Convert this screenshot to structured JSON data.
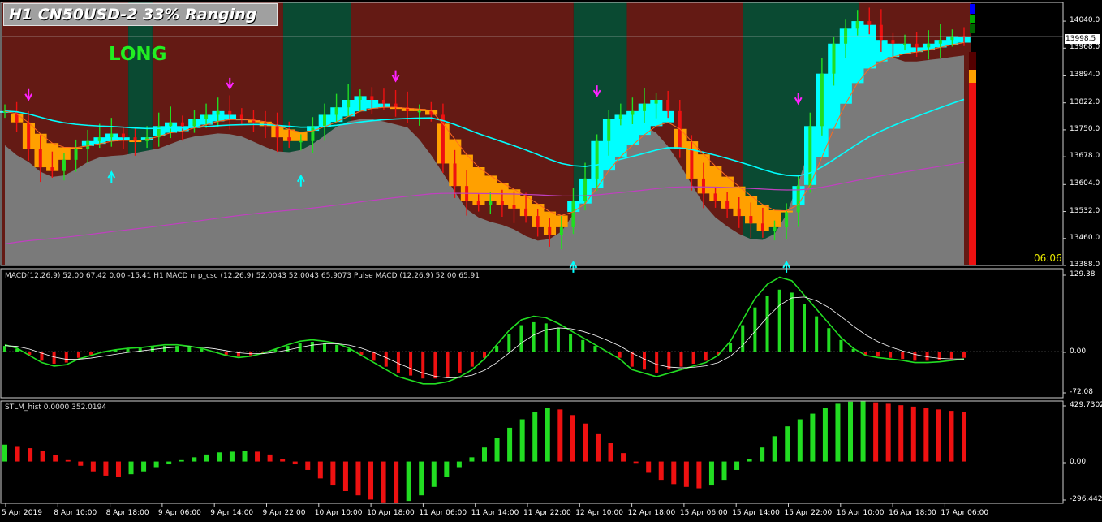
{
  "header": {
    "title": "H1 CN50USD-2  33% Ranging",
    "signal_label": "LONG",
    "countdown": "06:06"
  },
  "colors": {
    "background": "#000000",
    "bull_zone": "#0a4a32",
    "bear_zone": "#641a14",
    "cloud_fill": "#7a7a7a",
    "cyan_band": "#00ffff",
    "orange_band": "#ffa000",
    "green_bar": "#22dd22",
    "red_bar": "#ee1111",
    "magenta_line": "#c040c0",
    "signal_text": "#22ee22"
  },
  "price_axis": {
    "current_price": "13998.5",
    "ticks": [
      "14040.0",
      "13968.0",
      "13894.0",
      "13822.0",
      "13750.0",
      "13678.0",
      "13604.0",
      "13532.0",
      "13460.0",
      "13388.0"
    ]
  },
  "macd_panel": {
    "label": "MACD(12,26,9) 52.00 67.42 0.00 -15.41  H1 MACD nrp_csc (12,26,9) 52.0043 52.0043 65.9073  Pulse MACD (12,26,9) 52.00 65.91",
    "ticks": [
      "129.38",
      "0.00",
      "-72.08"
    ]
  },
  "stlm_panel": {
    "label": "STLM_hist 0.0000 352.0194",
    "ticks": [
      "429.7302",
      "0.00",
      "-296.4421"
    ]
  },
  "time_axis": {
    "labels": [
      "5 Apr 2019",
      "8 Apr 10:00",
      "8 Apr 18:00",
      "9 Apr 06:00",
      "9 Apr 14:00",
      "9 Apr 22:00",
      "10 Apr 10:00",
      "10 Apr 18:00",
      "11 Apr 06:00",
      "11 Apr 14:00",
      "11 Apr 22:00",
      "12 Apr 10:00",
      "12 Apr 18:00",
      "15 Apr 06:00",
      "15 Apr 14:00",
      "15 Apr 22:00",
      "16 Apr 10:00",
      "16 Apr 18:00",
      "17 Apr 06:00"
    ]
  },
  "chart_data": [
    {
      "type": "line",
      "title": "H1 CN50USD-2",
      "ylim": [
        13388,
        14090
      ],
      "close": [
        13800,
        13770,
        13700,
        13650,
        13640,
        13670,
        13700,
        13720,
        13730,
        13740,
        13730,
        13720,
        13730,
        13760,
        13770,
        13760,
        13780,
        13790,
        13800,
        13790,
        13780,
        13770,
        13760,
        13730,
        13720,
        13720,
        13760,
        13790,
        13810,
        13830,
        13840,
        13830,
        13820,
        13810,
        13800,
        13800,
        13790,
        13660,
        13600,
        13560,
        13550,
        13560,
        13550,
        13540,
        13520,
        13490,
        13470,
        13490,
        13560,
        13620,
        13720,
        13780,
        13790,
        13800,
        13820,
        13830,
        13800,
        13700,
        13620,
        13580,
        13560,
        13540,
        13520,
        13500,
        13480,
        13490,
        13530,
        13600,
        13760,
        13900,
        13980,
        14020,
        14040,
        14030,
        13990,
        13980,
        13980,
        13970,
        13980,
        13990,
        14000,
        13998.5
      ]
    },
    {
      "type": "bar",
      "title": "MACD(12,26,9)",
      "ylim": [
        -72.08,
        129.38
      ],
      "values": [
        10,
        5,
        -5,
        -15,
        -20,
        -18,
        -10,
        -5,
        0,
        3,
        5,
        6,
        8,
        10,
        10,
        8,
        5,
        0,
        -5,
        -8,
        -6,
        -2,
        4,
        10,
        15,
        17,
        15,
        12,
        5,
        -5,
        -15,
        -25,
        -35,
        -40,
        -45,
        -45,
        -42,
        -35,
        -25,
        -10,
        10,
        30,
        45,
        50,
        48,
        40,
        30,
        20,
        10,
        0,
        -10,
        -25,
        -30,
        -35,
        -30,
        -25,
        -20,
        -15,
        -5,
        15,
        45,
        75,
        95,
        105,
        100,
        80,
        60,
        40,
        20,
        5,
        -5,
        -8,
        -10,
        -12,
        -15,
        -15,
        -14,
        -12,
        -10
      ]
    },
    {
      "type": "bar",
      "title": "STLM_hist",
      "ylim": [
        -296.4421,
        429.7302
      ],
      "values": [
        120,
        110,
        95,
        75,
        45,
        10,
        -30,
        -70,
        -100,
        -110,
        -90,
        -70,
        -40,
        -20,
        10,
        30,
        50,
        65,
        70,
        75,
        70,
        50,
        20,
        -20,
        -60,
        -120,
        -170,
        -210,
        -240,
        -270,
        -290,
        -296,
        -280,
        -240,
        -180,
        -110,
        -40,
        30,
        100,
        170,
        240,
        300,
        350,
        380,
        370,
        330,
        270,
        200,
        130,
        60,
        -10,
        -80,
        -130,
        -160,
        -180,
        -190,
        -170,
        -130,
        -60,
        20,
        100,
        180,
        250,
        300,
        340,
        380,
        410,
        425,
        429,
        420,
        410,
        400,
        390,
        380,
        370,
        360,
        352
      ]
    }
  ]
}
